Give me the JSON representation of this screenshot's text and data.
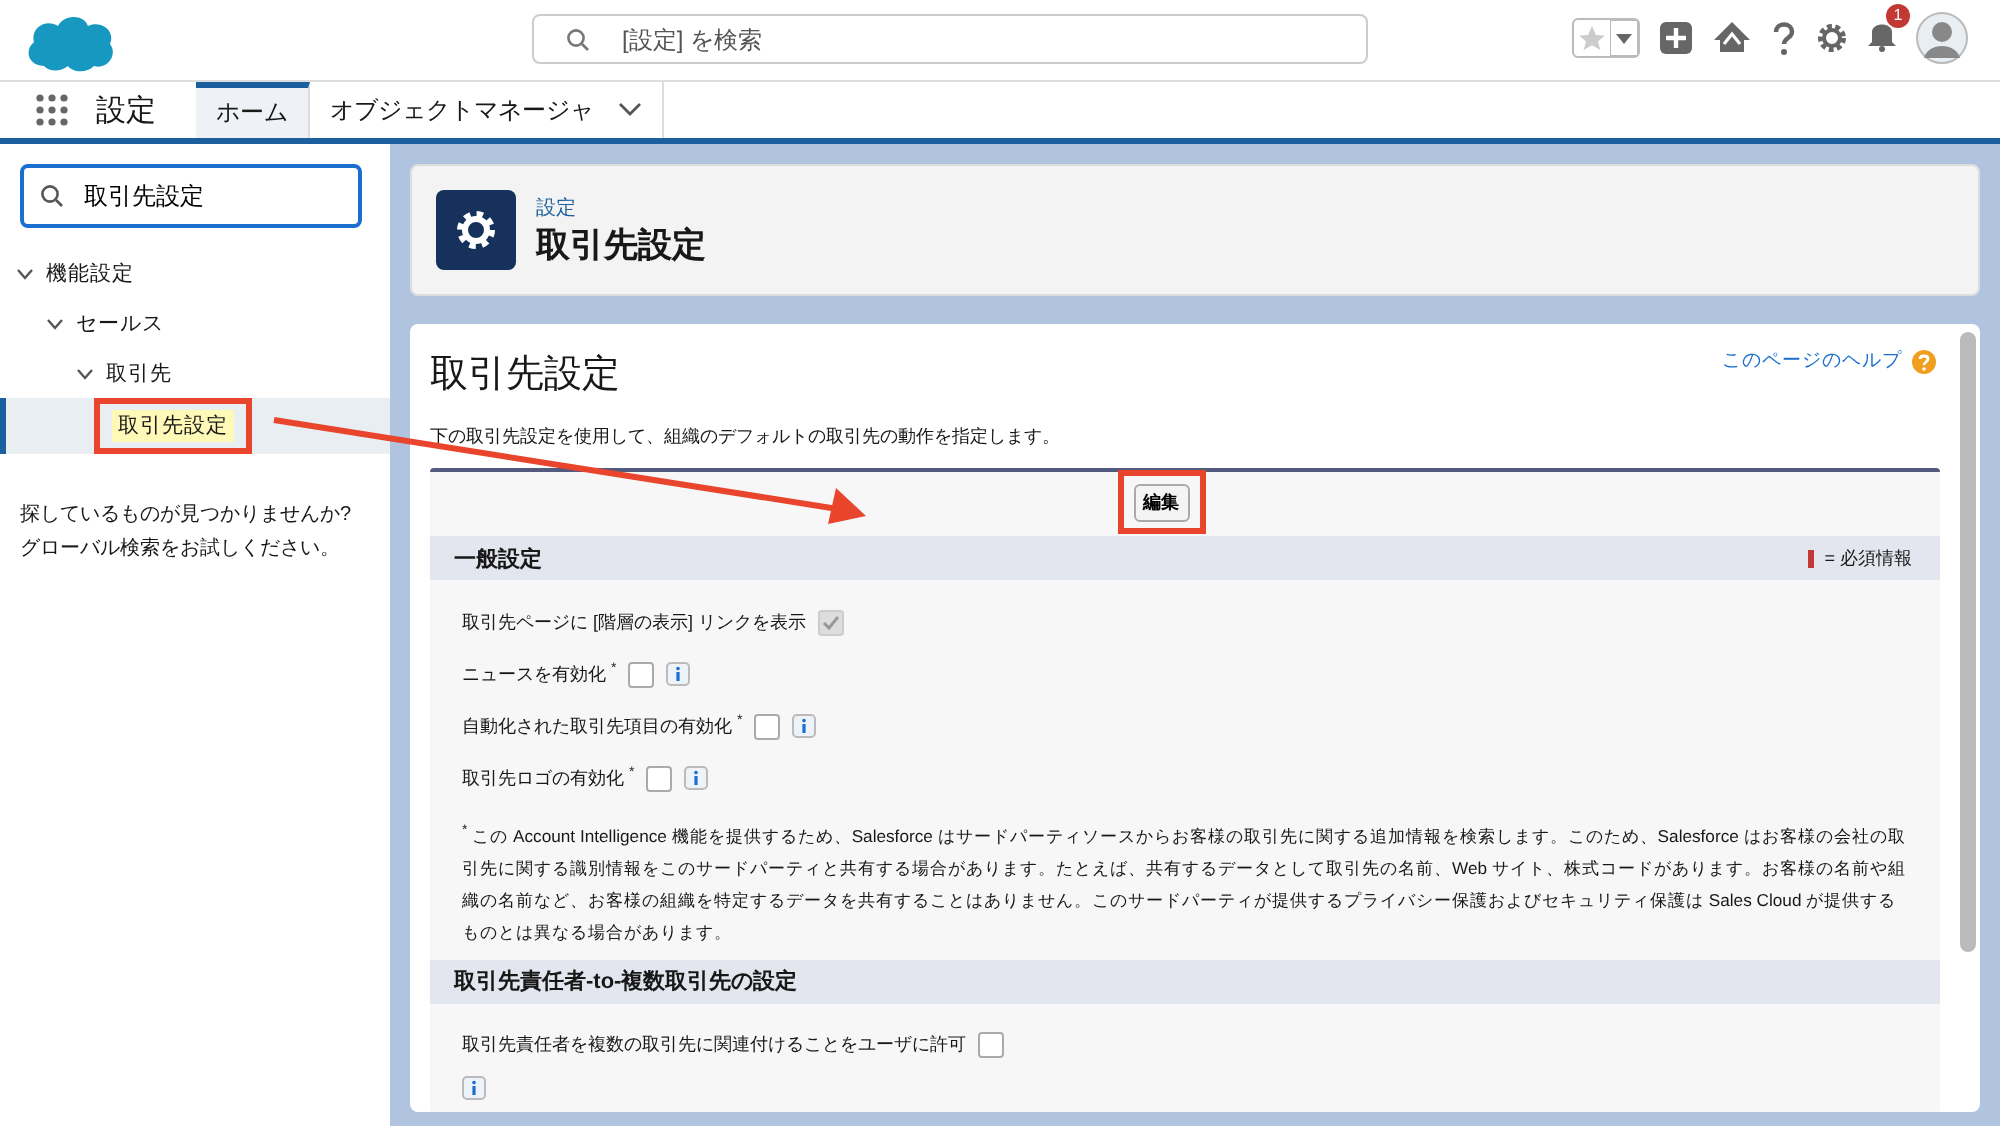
{
  "header": {
    "search_placeholder": "[設定] を検索",
    "notification_count": "1"
  },
  "nav": {
    "app_name": "設定",
    "tabs": [
      {
        "label": "ホーム",
        "selected": true,
        "dropdown": false
      },
      {
        "label": "オブジェクトマネージャ",
        "selected": false,
        "dropdown": true
      }
    ]
  },
  "sidebar": {
    "search_value": "取引先設定",
    "tree": [
      {
        "label": "機能設定",
        "expanded": true,
        "selected": false,
        "children": [
          {
            "label": "セールス",
            "expanded": true,
            "selected": false,
            "children": [
              {
                "label": "取引先",
                "expanded": true,
                "selected": false,
                "children": [
                  {
                    "label": "取引先設定",
                    "selected": true,
                    "callout": true
                  }
                ]
              }
            ]
          }
        ]
      }
    ],
    "help_lines": [
      "探しているものが見つかりませんか?",
      "グローバル検索をお試しください。"
    ]
  },
  "page_header": {
    "breadcrumb": "設定",
    "title": "取引先設定"
  },
  "content": {
    "title": "取引先設定",
    "help_link": "このページのヘルプ",
    "description": "下の取引先設定を使用して、組織のデフォルトの取引先の動作を指定します。",
    "edit_button": {
      "label": "編集",
      "callout": true
    },
    "sections": [
      {
        "title": "一般設定",
        "required_legend": "= 必須情報",
        "fields": [
          {
            "label": "取引先ページに [階層の表示] リンクを表示",
            "checked": true,
            "disabled": true,
            "info": false
          },
          {
            "label": "ニュースを有効化 $^{*}$",
            "checked": false,
            "disabled": false,
            "info": true,
            "info_below": false
          },
          {
            "label": "自動化された取引先項目の有効化 $^{*}$",
            "checked": false,
            "disabled": false,
            "info": true,
            "info_below": false
          },
          {
            "label": "取引先ロゴの有効化 $^{*}$",
            "checked": false,
            "disabled": false,
            "info": true,
            "info_below": false
          }
        ],
        "note": "$^{*}$ この Account Intelligence 機能を提供するため、Salesforce はサードパーティソースからお客様の取引先に関する追加情報を検索します。このため、Salesforce はお客様の会社の取引先に関する識別情報をこのサードパーティと共有する場合があります。たとえば、共有するデータとして取引先の名前、Web サイト、株式コードがあります。お客様の名前や組織の名前など、お客様の組織を特定するデータを共有することはありません。このサードパーティが提供するプライバシー保護およびセキュリティ保護は Sales Cloud が提供するものとは異なる場合があります。"
      },
      {
        "title": "取引先責任者-to-複数取引先の設定",
        "fields": [
          {
            "label": "取引先責任者を複数の取引先に関連付けることをユーザに許可",
            "checked": false,
            "disabled": false,
            "info": true,
            "info_below": true
          }
        ]
      }
    ]
  }
}
